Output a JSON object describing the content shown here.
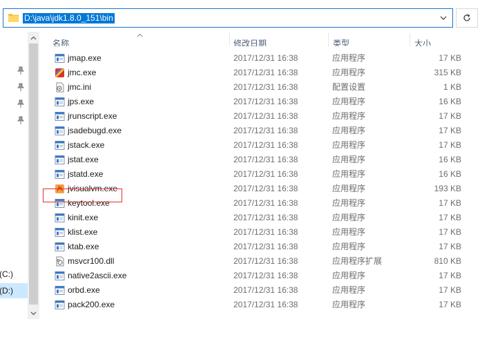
{
  "address_bar": {
    "path": "D:\\java\\jdk1.8.0_151\\bin"
  },
  "nav": {
    "drives": [
      {
        "label": "(C:)",
        "selected": false
      },
      {
        "label": "(D:)",
        "selected": true
      }
    ]
  },
  "columns": {
    "name": "名称",
    "date": "修改日期",
    "type": "类型",
    "size": "大小"
  },
  "files": [
    {
      "name": "jmap.exe",
      "date": "2017/12/31 16:38",
      "type": "应用程序",
      "size": "17 KB",
      "icon": "exe-icon"
    },
    {
      "name": "jmc.exe",
      "date": "2017/12/31 16:38",
      "type": "应用程序",
      "size": "315 KB",
      "icon": "jmc-icon"
    },
    {
      "name": "jmc.ini",
      "date": "2017/12/31 16:38",
      "type": "配置设置",
      "size": "1 KB",
      "icon": "ini-icon"
    },
    {
      "name": "jps.exe",
      "date": "2017/12/31 16:38",
      "type": "应用程序",
      "size": "16 KB",
      "icon": "exe-icon"
    },
    {
      "name": "jrunscript.exe",
      "date": "2017/12/31 16:38",
      "type": "应用程序",
      "size": "17 KB",
      "icon": "exe-icon"
    },
    {
      "name": "jsadebugd.exe",
      "date": "2017/12/31 16:38",
      "type": "应用程序",
      "size": "17 KB",
      "icon": "exe-icon"
    },
    {
      "name": "jstack.exe",
      "date": "2017/12/31 16:38",
      "type": "应用程序",
      "size": "17 KB",
      "icon": "exe-icon"
    },
    {
      "name": "jstat.exe",
      "date": "2017/12/31 16:38",
      "type": "应用程序",
      "size": "16 KB",
      "icon": "exe-icon"
    },
    {
      "name": "jstatd.exe",
      "date": "2017/12/31 16:38",
      "type": "应用程序",
      "size": "16 KB",
      "icon": "exe-icon"
    },
    {
      "name": "jvisualvm.exe",
      "date": "2017/12/31 16:38",
      "type": "应用程序",
      "size": "193 KB",
      "icon": "jvisualvm-icon"
    },
    {
      "name": "keytool.exe",
      "date": "2017/12/31 16:38",
      "type": "应用程序",
      "size": "17 KB",
      "icon": "exe-icon"
    },
    {
      "name": "kinit.exe",
      "date": "2017/12/31 16:38",
      "type": "应用程序",
      "size": "17 KB",
      "icon": "exe-icon"
    },
    {
      "name": "klist.exe",
      "date": "2017/12/31 16:38",
      "type": "应用程序",
      "size": "17 KB",
      "icon": "exe-icon"
    },
    {
      "name": "ktab.exe",
      "date": "2017/12/31 16:38",
      "type": "应用程序",
      "size": "17 KB",
      "icon": "exe-icon"
    },
    {
      "name": "msvcr100.dll",
      "date": "2017/12/31 16:38",
      "type": "应用程序扩展",
      "size": "810 KB",
      "icon": "dll-icon"
    },
    {
      "name": "native2ascii.exe",
      "date": "2017/12/31 16:38",
      "type": "应用程序",
      "size": "17 KB",
      "icon": "exe-icon"
    },
    {
      "name": "orbd.exe",
      "date": "2017/12/31 16:38",
      "type": "应用程序",
      "size": "17 KB",
      "icon": "exe-icon"
    },
    {
      "name": "pack200.exe",
      "date": "2017/12/31 16:38",
      "type": "应用程序",
      "size": "17 KB",
      "icon": "exe-icon"
    }
  ],
  "colors": {
    "selection_blue": "#0078d7",
    "selected_drive_bg": "#cce8ff",
    "highlight_box": "#e0302b",
    "header_text": "#4c607a"
  }
}
